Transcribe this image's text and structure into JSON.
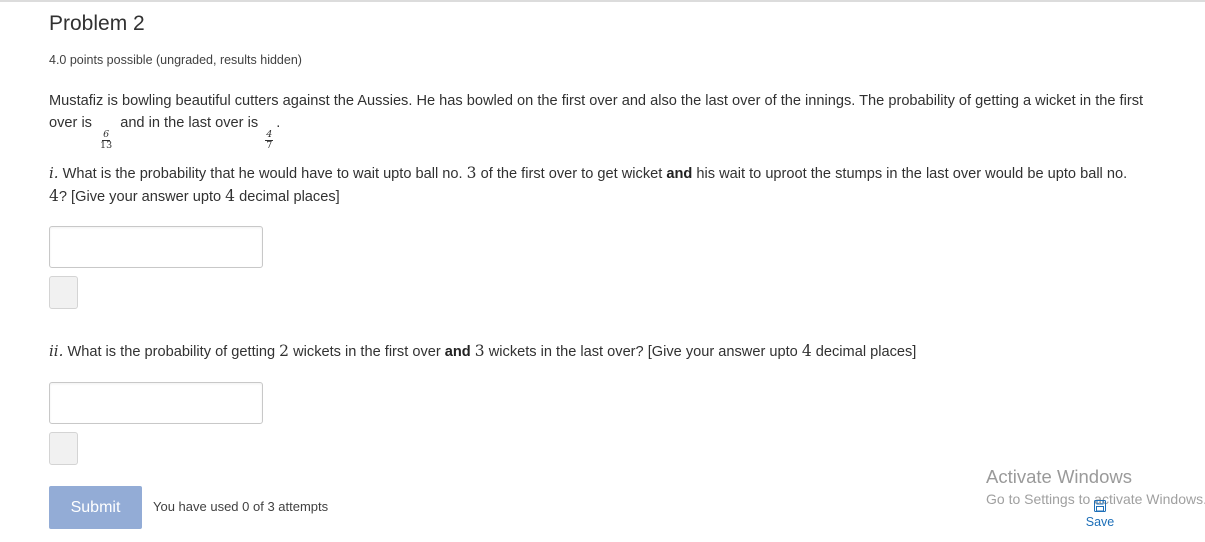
{
  "problem": {
    "title": "Problem 2",
    "points": "4.0 points possible (ungraded, results hidden)"
  },
  "intro": {
    "text_a": "Mustafiz is bowling beautiful cutters against the Aussies. He has bowled on the first over and also the last over of the innings. The probability of getting a wicket in the first over is",
    "frac1_num": "6",
    "frac1_den": "13",
    "text_b": "and in the last over is",
    "frac2_num": "4",
    "frac2_den": "7",
    "text_c": "."
  },
  "q1": {
    "label": "i.",
    "text_a": "What is the probability that he would have to wait upto ball no.",
    "num1": "3",
    "text_b": "of the first over to get wicket",
    "bold": "and",
    "text_c": "his wait to uproot the stumps in the last over would be upto ball no.",
    "num2": "4",
    "text_d": "? [Give your answer upto",
    "num3": "4",
    "text_e": "decimal places]",
    "input_value": ""
  },
  "q2": {
    "label": "ii.",
    "text_a": "What is the probability of getting",
    "num1": "2",
    "text_b": "wickets in the first over",
    "bold": "and",
    "num2": "3",
    "text_c": "wickets in the last over? [Give your answer upto",
    "num3": "4",
    "text_d": "decimal places]",
    "input_value": ""
  },
  "actions": {
    "submit_label": "Submit",
    "attempts_text": "You have used 0 of 3 attempts",
    "save_label": "Save"
  },
  "watermark": {
    "title": "Activate Windows",
    "subtitle": "Go to Settings to activate Windows."
  },
  "icons": {
    "save": "save-icon"
  },
  "colors": {
    "submit_bg": "#93acd6",
    "link": "#1d6fb8"
  }
}
